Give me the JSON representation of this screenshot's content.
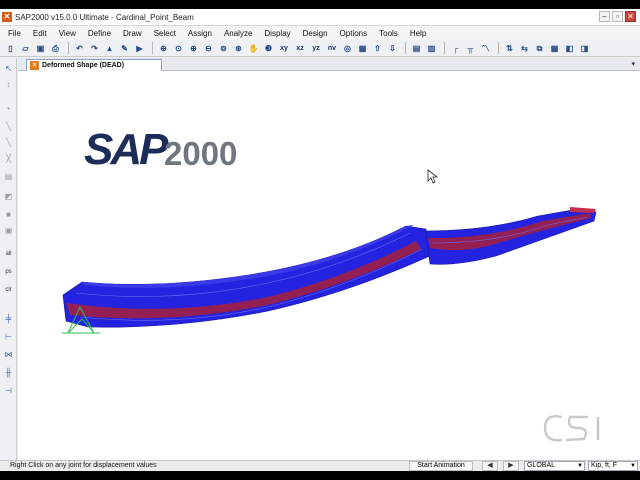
{
  "window": {
    "title": "SAP2000 v15.0.0 Ultimate  - Cardinal_Point_Beam",
    "minimize": "–",
    "maximize": "▫",
    "close": "✕"
  },
  "menu": [
    "File",
    "Edit",
    "View",
    "Define",
    "Draw",
    "Select",
    "Assign",
    "Analyze",
    "Display",
    "Design",
    "Options",
    "Tools",
    "Help"
  ],
  "toolbar": {
    "view_labels": [
      "xy",
      "xz",
      "yz",
      "nv"
    ]
  },
  "left_toolbar": {
    "labels": [
      "all",
      "ps",
      "clr"
    ]
  },
  "document": {
    "tab_label": "Deformed Shape (DEAD)",
    "tab_dropdown": "▾"
  },
  "canvas": {
    "logo_text": "SAP2000",
    "watermark": "CSI"
  },
  "colors": {
    "beam_blue": "#2323e0",
    "beam_red": "#a81f3a",
    "support_green": "#2fbf4a",
    "logo_navy": "#1c2d5a",
    "logo_gray": "#6f7680"
  },
  "status": {
    "message": "Right Click on any joint for displacement values",
    "animation_button": "Start Animation",
    "prev": "◀",
    "next": "▶",
    "coord_system": "GLOBAL",
    "units": "Kip, ft, F"
  }
}
